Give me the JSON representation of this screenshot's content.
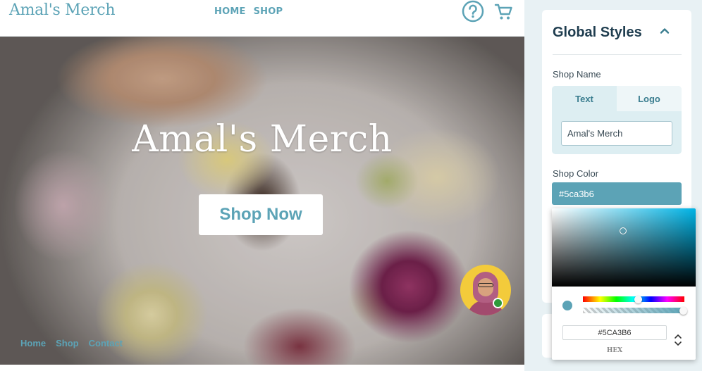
{
  "store": {
    "logo": "Amal's Merch",
    "nav": [
      {
        "label": "HOME"
      },
      {
        "label": "SHOP"
      }
    ],
    "hero_title": "Amal's Merch",
    "cta_label": "Shop Now",
    "footer_links": [
      {
        "label": "Home"
      },
      {
        "label": "Shop"
      },
      {
        "label": "Contact"
      }
    ],
    "icons": {
      "help": "help-circle-icon",
      "cart": "shopping-cart-icon"
    }
  },
  "panel": {
    "title": "Global Styles",
    "shop_name_label": "Shop Name",
    "tabs": [
      {
        "label": "Text",
        "active": true
      },
      {
        "label": "Logo",
        "active": false
      }
    ],
    "shop_name_value": "Amal's Merch",
    "shop_color_label": "Shop Color",
    "shop_color_value": "#5ca3b6"
  },
  "picker": {
    "hex_value": "#5CA3B6",
    "mode_label": "HEX"
  },
  "colors": {
    "accent": "#5ca3b6",
    "panel_title": "#1f3d4f",
    "online": "#2e9a3a"
  }
}
